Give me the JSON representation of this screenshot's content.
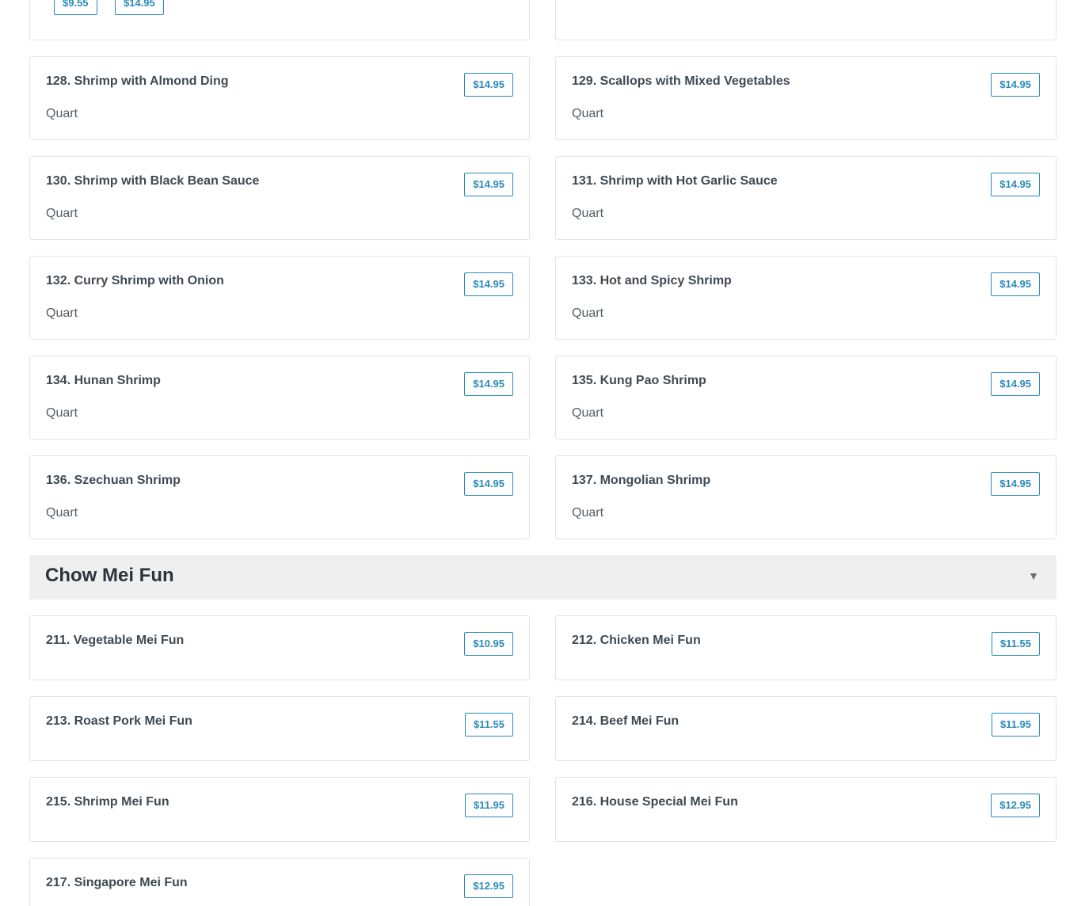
{
  "top_partial": {
    "prices": [
      "$9.55",
      "$14.95"
    ]
  },
  "items_a": [
    {
      "name": "128. Shrimp with Almond Ding",
      "desc": "Quart",
      "price": "$14.95"
    },
    {
      "name": "129. Scallops with Mixed Vegetables",
      "desc": "Quart",
      "price": "$14.95"
    },
    {
      "name": "130. Shrimp with Black Bean Sauce",
      "desc": "Quart",
      "price": "$14.95"
    },
    {
      "name": "131. Shrimp with Hot Garlic Sauce",
      "desc": "Quart",
      "price": "$14.95"
    },
    {
      "name": "132. Curry Shrimp with Onion",
      "desc": "Quart",
      "price": "$14.95"
    },
    {
      "name": "133. Hot and Spicy Shrimp",
      "desc": "Quart",
      "price": "$14.95"
    },
    {
      "name": "134. Hunan Shrimp",
      "desc": "Quart",
      "price": "$14.95"
    },
    {
      "name": "135. Kung Pao Shrimp",
      "desc": "Quart",
      "price": "$14.95"
    },
    {
      "name": "136. Szechuan Shrimp",
      "desc": "Quart",
      "price": "$14.95"
    },
    {
      "name": "137. Mongolian Shrimp",
      "desc": "Quart",
      "price": "$14.95"
    }
  ],
  "section": {
    "title": "Chow Mei Fun",
    "caret_icon": "triangle-down-icon"
  },
  "items_b": [
    {
      "name": "211. Vegetable Mei Fun",
      "price": "$10.95"
    },
    {
      "name": "212. Chicken Mei Fun",
      "price": "$11.55"
    },
    {
      "name": "213. Roast Pork Mei Fun",
      "price": "$11.55"
    },
    {
      "name": "214. Beef Mei Fun",
      "price": "$11.95"
    },
    {
      "name": "215. Shrimp Mei Fun",
      "price": "$11.95"
    },
    {
      "name": "216. House Special Mei Fun",
      "price": "$12.95"
    },
    {
      "name": "217. Singapore Mei Fun",
      "price": "$12.95"
    }
  ],
  "colors": {
    "accent": "#2b8ab8",
    "header_bg": "#efefef",
    "border": "#e3e3e3"
  }
}
